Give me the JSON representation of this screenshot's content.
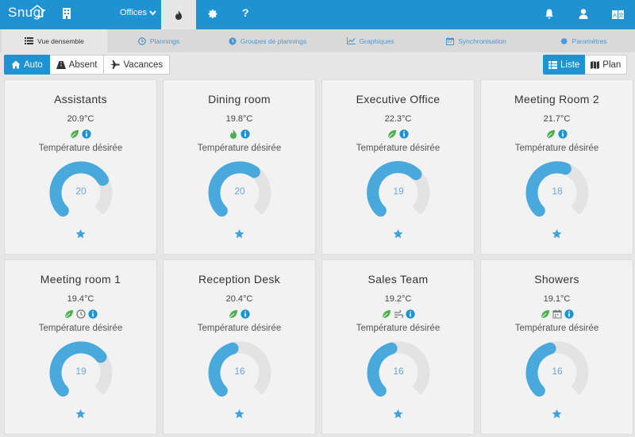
{
  "topbar": {
    "logo_text": "Snugr",
    "office_menu_label": "Offices",
    "icons": [
      "home-roof-icon",
      "building-icon",
      "flame-icon",
      "gear-icon",
      "help-icon",
      "bell-icon",
      "user-icon",
      "language-icon"
    ],
    "help_label": "?"
  },
  "tabs": [
    {
      "label": "Vue densemble",
      "icon": "list-icon"
    },
    {
      "label": "Plannings",
      "icon": "clock-icon"
    },
    {
      "label": "Groupes de plannings",
      "icon": "clock-icon"
    },
    {
      "label": "Graphiques",
      "icon": "chart-icon"
    },
    {
      "label": "Synchronisation",
      "icon": "calendar-icon"
    },
    {
      "label": "Paramètres",
      "icon": "gear-icon"
    }
  ],
  "modes": {
    "auto": "Auto",
    "absent": "Absent",
    "vacances": "Vacances"
  },
  "views": {
    "list": "Liste",
    "plan": "Plan"
  },
  "colors": {
    "primary": "#1f92d1",
    "gauge_fill": "#4aa9dc",
    "gauge_track": "#e3e3e3",
    "leaf_green": "#4caf50",
    "info_blue": "#1f92d1"
  },
  "rooms": [
    {
      "name": "Assistants",
      "temp": "20.9°C",
      "desired_label": "Température désirée",
      "setpoint": "20",
      "gauge_fraction": 0.72,
      "status_icons": [
        "leaf-icon",
        "info-icon"
      ]
    },
    {
      "name": "Dining room",
      "temp": "19.8°C",
      "desired_label": "Température désirée",
      "setpoint": "20",
      "gauge_fraction": 0.63,
      "status_icons": [
        "flame-icon",
        "info-icon"
      ]
    },
    {
      "name": "Executive Office",
      "temp": "22.3°C",
      "desired_label": "Température désirée",
      "setpoint": "19",
      "gauge_fraction": 0.66,
      "status_icons": [
        "leaf-icon",
        "info-icon"
      ]
    },
    {
      "name": "Meeting Room 2",
      "temp": "21.7°C",
      "desired_label": "Température désirée",
      "setpoint": "18",
      "gauge_fraction": 0.57,
      "status_icons": [
        "leaf-icon",
        "info-icon"
      ]
    },
    {
      "name": "Meeting room 1",
      "temp": "19.4°C",
      "desired_label": "Température désirée",
      "setpoint": "19",
      "gauge_fraction": 0.69,
      "status_icons": [
        "leaf-icon",
        "clock-icon",
        "info-icon"
      ]
    },
    {
      "name": "Reception Desk",
      "temp": "20.4°C",
      "desired_label": "Température désirée",
      "setpoint": "16",
      "gauge_fraction": 0.44,
      "status_icons": [
        "leaf-icon",
        "info-icon"
      ]
    },
    {
      "name": "Sales Team",
      "temp": "19.2°C",
      "desired_label": "Température désirée",
      "setpoint": "16",
      "gauge_fraction": 0.44,
      "status_icons": [
        "leaf-icon",
        "wind-icon",
        "info-icon"
      ]
    },
    {
      "name": "Showers",
      "temp": "19.1°C",
      "desired_label": "Température désirée",
      "setpoint": "16",
      "gauge_fraction": 0.44,
      "status_icons": [
        "leaf-icon",
        "calendar-icon",
        "info-icon"
      ]
    }
  ]
}
